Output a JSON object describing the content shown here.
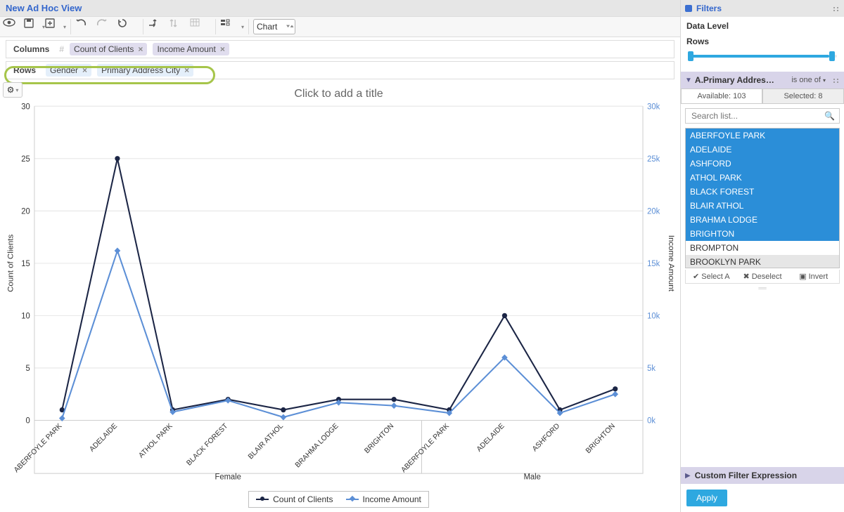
{
  "header": {
    "view_title": "New Ad Hoc View"
  },
  "toolbar": {
    "chart_type_label": "Chart",
    "icons": [
      "eye-icon",
      "save-icon",
      "export-icon",
      "undo-icon",
      "redo-icon",
      "reload-icon",
      "pivot-icon",
      "sort-icon",
      "table-icon",
      "options-icon"
    ]
  },
  "shelves": {
    "columns_label": "Columns",
    "rows_label": "Rows",
    "column_fields": [
      {
        "label": "Count of Clients",
        "type": "measure"
      },
      {
        "label": "Income Amount",
        "type": "measure"
      }
    ],
    "row_fields": [
      {
        "label": "Gender",
        "type": "dimension"
      },
      {
        "label": "Primary Address City",
        "type": "dimension"
      }
    ]
  },
  "chart": {
    "title_placeholder": "Click to add a title",
    "left_axis_label": "Count of Clients",
    "right_axis_label": "Income Amount",
    "legend": [
      "Count of Clients",
      "Income Amount"
    ]
  },
  "chart_data": {
    "type": "line",
    "y_left": {
      "label": "Count of Clients",
      "min": 0,
      "max": 30,
      "ticks": [
        0,
        5,
        10,
        15,
        20,
        25,
        30
      ]
    },
    "y_right": {
      "label": "Income Amount",
      "min": 0,
      "max": 30000,
      "unit_suffix": "k",
      "ticks_display": [
        "0k",
        "5k",
        "10k",
        "15k",
        "20k",
        "25k",
        "30k"
      ]
    },
    "groups": [
      {
        "name": "Female",
        "categories": [
          "ABERFOYLE PARK",
          "ADELAIDE",
          "ATHOL PARK",
          "BLACK FOREST",
          "BLAIR ATHOL",
          "BRAHMA LODGE",
          "BRIGHTON"
        ]
      },
      {
        "name": "Male",
        "categories": [
          "ABERFOYLE PARK",
          "ADELAIDE",
          "ASHFORD",
          "BRIGHTON"
        ]
      }
    ],
    "series": [
      {
        "name": "Count of Clients",
        "axis": "left",
        "color": "#1b2545",
        "marker": "circle",
        "values": [
          1,
          25,
          1,
          2,
          1,
          2,
          2,
          1,
          10,
          1,
          3
        ]
      },
      {
        "name": "Income Amount",
        "axis": "right",
        "color": "#5c8fd6",
        "marker": "diamond",
        "values": [
          200,
          16200,
          800,
          1900,
          300,
          1700,
          1400,
          700,
          6000,
          700,
          2500
        ]
      }
    ]
  },
  "filters_panel": {
    "title": "Filters",
    "data_level_label": "Data Level",
    "rows_level_label": "Rows",
    "filter_name": "A.Primary Addres…",
    "operator_label": "is one of",
    "tabs": {
      "available": "Available: 103",
      "selected": "Selected: 8"
    },
    "search_placeholder": "Search list...",
    "cities": [
      {
        "name": "ABERFOYLE PARK",
        "selected": true
      },
      {
        "name": "ADELAIDE",
        "selected": true
      },
      {
        "name": "ASHFORD",
        "selected": true
      },
      {
        "name": "ATHOL PARK",
        "selected": true
      },
      {
        "name": "BLACK FOREST",
        "selected": true
      },
      {
        "name": "BLAIR ATHOL",
        "selected": true
      },
      {
        "name": "BRAHMA LODGE",
        "selected": true
      },
      {
        "name": "BRIGHTON",
        "selected": true
      },
      {
        "name": "BROMPTON",
        "selected": false
      },
      {
        "name": "BROOKLYN PARK",
        "selected": false,
        "hover": true
      }
    ],
    "select_all": "Select A",
    "deselect": "Deselect",
    "invert": "Invert",
    "cfe_label": "Custom Filter Expression",
    "apply_label": "Apply"
  }
}
